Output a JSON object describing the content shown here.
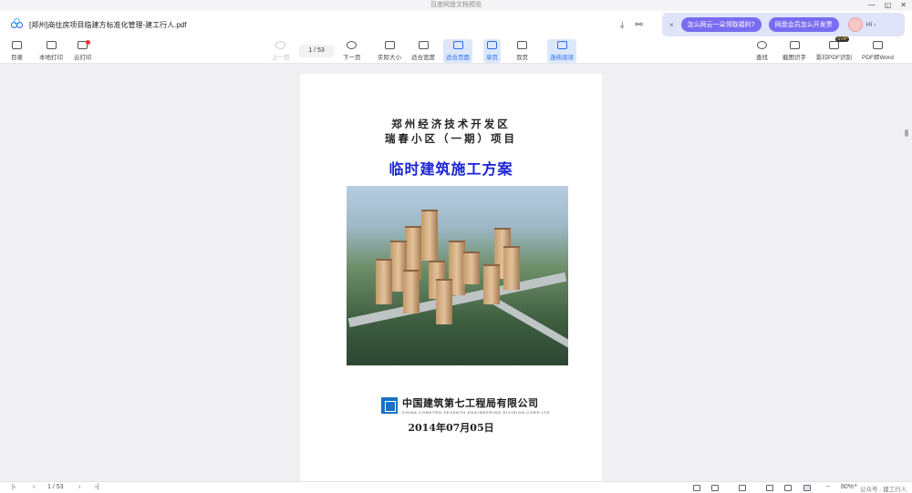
{
  "window": {
    "title": "百度网盘文档预览",
    "controls": [
      "—",
      "◱",
      "✕"
    ]
  },
  "file": {
    "name": "[郑州]商住房项目临建方标准化管理-建工行人.pdf"
  },
  "promo": {
    "close": "×",
    "q1": "怎么网云一朵领取福利?",
    "q2": "网盘会员怎么开发票",
    "hi": "Hi ›"
  },
  "toolbar": {
    "toc": "目录",
    "local_print": "本地打印",
    "cloud_print": "云打印",
    "prev": "上一页",
    "page_indicator": "1 / 53",
    "next": "下一页",
    "actual_size": "实际大小",
    "fit_width": "适合宽度",
    "fit_page": "适合页面",
    "single": "单页",
    "double": "双页",
    "continuous": "连续阅读",
    "find": "查找",
    "ocr": "截图识字",
    "to_pdf": "影印PDF识别",
    "vip": "SVIP",
    "pdf2word": "PDF转Word"
  },
  "document": {
    "line1": "郑州经济技术开发区",
    "line2": "瑞春小区（一期）项目",
    "title": "临时建筑施工方案",
    "company_zh": "中国建筑第七工程局有限公司",
    "company_en": "CHINA CONSTRN SEVENTH ENGINEERING DIVISION CORP.LTD",
    "date": "2014年07月05日"
  },
  "statusbar": {
    "page_indicator": "1 / 53",
    "zoom": "80%",
    "zoom_minus": "−",
    "zoom_plus": "+",
    "watermark": "公众号 · 建工行人"
  }
}
